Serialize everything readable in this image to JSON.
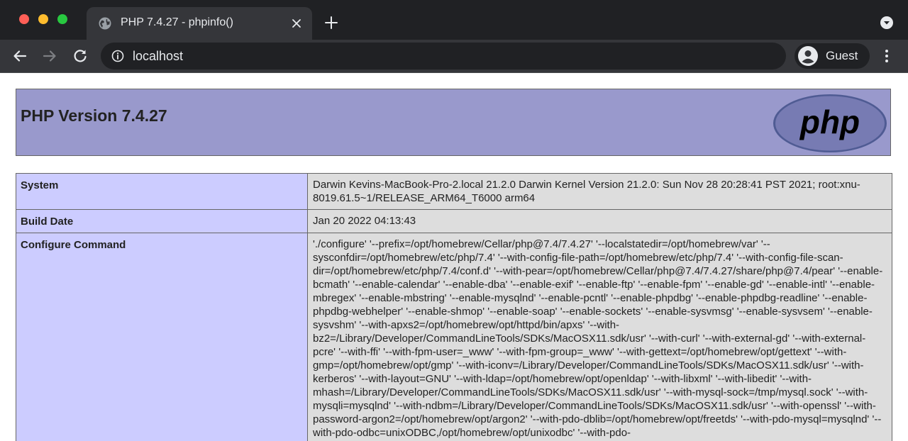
{
  "browser": {
    "tab_title": "PHP 7.4.27 - phpinfo()",
    "url": "localhost",
    "profile_name": "Guest"
  },
  "page": {
    "heading": "PHP Version 7.4.27",
    "logo_text": "php",
    "rows": [
      {
        "label": "System",
        "value": "Darwin Kevins-MacBook-Pro-2.local 21.2.0 Darwin Kernel Version 21.2.0: Sun Nov 28 20:28:41 PST 2021; root:xnu-8019.61.5~1/RELEASE_ARM64_T6000 arm64"
      },
      {
        "label": "Build Date",
        "value": "Jan 20 2022 04:13:43"
      },
      {
        "label": "Configure Command",
        "value": "'./configure' '--prefix=/opt/homebrew/Cellar/php@7.4/7.4.27' '--localstatedir=/opt/homebrew/var' '--sysconfdir=/opt/homebrew/etc/php/7.4' '--with-config-file-path=/opt/homebrew/etc/php/7.4' '--with-config-file-scan-dir=/opt/homebrew/etc/php/7.4/conf.d' '--with-pear=/opt/homebrew/Cellar/php@7.4/7.4.27/share/php@7.4/pear' '--enable-bcmath' '--enable-calendar' '--enable-dba' '--enable-exif' '--enable-ftp' '--enable-fpm' '--enable-gd' '--enable-intl' '--enable-mbregex' '--enable-mbstring' '--enable-mysqlnd' '--enable-pcntl' '--enable-phpdbg' '--enable-phpdbg-readline' '--enable-phpdbg-webhelper' '--enable-shmop' '--enable-soap' '--enable-sockets' '--enable-sysvmsg' '--enable-sysvsem' '--enable-sysvshm' '--with-apxs2=/opt/homebrew/opt/httpd/bin/apxs' '--with-bz2=/Library/Developer/CommandLineTools/SDKs/MacOSX11.sdk/usr' '--with-curl' '--with-external-gd' '--with-external-pcre' '--with-ffi' '--with-fpm-user=_www' '--with-fpm-group=_www' '--with-gettext=/opt/homebrew/opt/gettext' '--with-gmp=/opt/homebrew/opt/gmp' '--with-iconv=/Library/Developer/CommandLineTools/SDKs/MacOSX11.sdk/usr' '--with-kerberos' '--with-layout=GNU' '--with-ldap=/opt/homebrew/opt/openldap' '--with-libxml' '--with-libedit' '--with-mhash=/Library/Developer/CommandLineTools/SDKs/MacOSX11.sdk/usr' '--with-mysql-sock=/tmp/mysql.sock' '--with-mysqli=mysqlnd' '--with-ndbm=/Library/Developer/CommandLineTools/SDKs/MacOSX11.sdk/usr' '--with-openssl' '--with-password-argon2=/opt/homebrew/opt/argon2' '--with-pdo-dblib=/opt/homebrew/opt/freetds' '--with-pdo-mysql=mysqlnd' '--with-pdo-odbc=unixODBC,/opt/homebrew/opt/unixodbc' '--with-pdo-"
      }
    ]
  },
  "icons": {
    "tab_favicon": "globe-icon",
    "tab_close": "close-icon",
    "new_tab": "plus-icon",
    "tab_search": "chevron-down-circle-icon",
    "back": "arrow-left-icon",
    "forward": "arrow-right-icon",
    "reload": "reload-icon",
    "site_info": "info-icon",
    "profile": "person-icon",
    "menu": "kebab-menu-icon"
  },
  "colors": {
    "header_bg": "#9999cc",
    "label_cell_bg": "#ccccff",
    "value_cell_bg": "#dddddd",
    "logo_bg": "#777bb3"
  }
}
